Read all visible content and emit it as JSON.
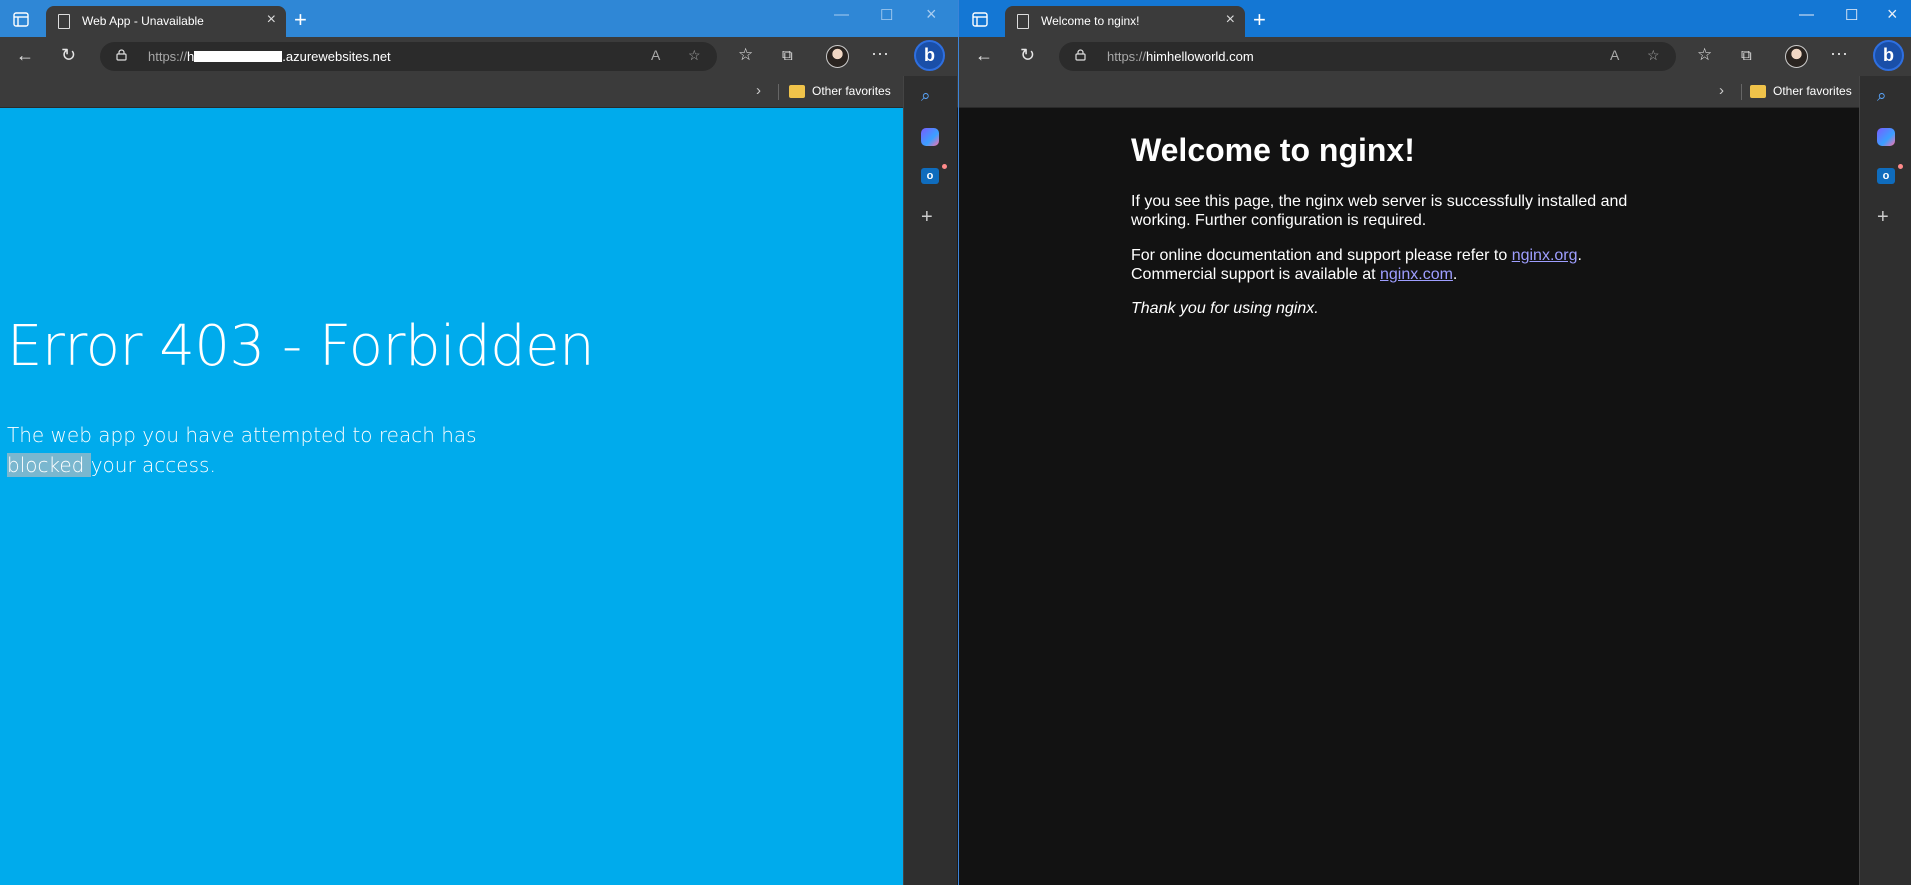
{
  "left_window": {
    "tab_title": "Web App - Unavailable",
    "url_protocol": "https://",
    "url_prefix": "h",
    "url_host": ".azurewebsites.net",
    "favorites_label": "Other favorites",
    "page": {
      "heading": "Error 403 - Forbidden",
      "line_1": "The web app you have attempted to reach has",
      "highlighted": "blocked ",
      "line_2_rest": "your access.",
      "background_color": "#00abec"
    }
  },
  "right_window": {
    "tab_title": "Welcome to nginx!",
    "url_protocol": "https://",
    "url_host": "himhelloworld.com",
    "favorites_label": "Other favorites",
    "page": {
      "heading": "Welcome to nginx!",
      "para1": "If you see this page, the nginx web server is successfully installed and working. Further configuration is required.",
      "para2_text": "For online documentation and support please refer to ",
      "para2_link": "nginx.org",
      "para2_tail": ".",
      "para2_text2": "Commercial support is available at ",
      "para2_link2": "nginx.com",
      "para2_tail2": ".",
      "para3": "Thank you for using nginx.",
      "link_color": "#9e9eff"
    }
  },
  "icons": {
    "close": "×",
    "new_tab": "+",
    "minimize": "—",
    "maximize": "☐",
    "back": "←",
    "reload": "↻",
    "more": "···",
    "bing_letter": "b",
    "outlook_letter": "o",
    "add": "+"
  }
}
